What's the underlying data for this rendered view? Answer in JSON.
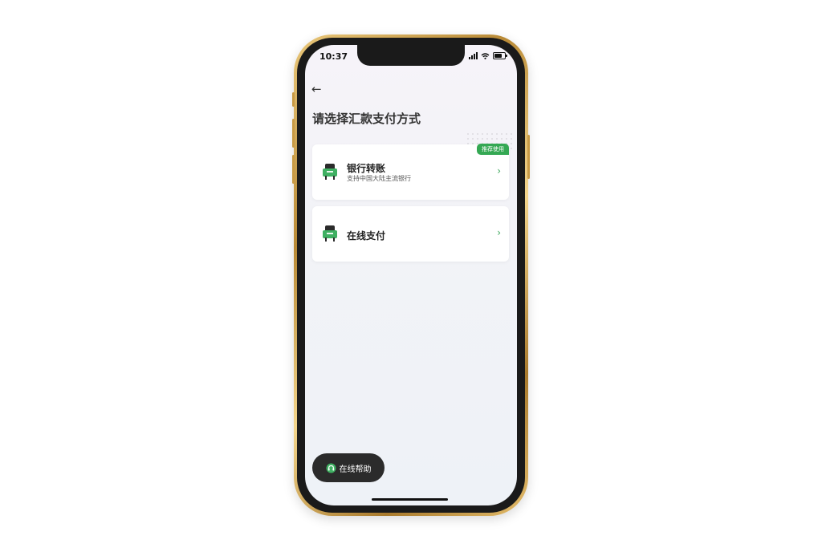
{
  "status_bar": {
    "time": "10:37"
  },
  "header": {
    "back_icon": "arrow-left-icon",
    "title": "请选择汇款支付方式"
  },
  "options": [
    {
      "title": "银行转账",
      "subtitle": "支持中国大陆主流银行",
      "badge": "推荐使用",
      "icon": "green-card-icon"
    },
    {
      "title": "在线支付",
      "icon": "green-card-icon"
    }
  ],
  "help": {
    "label": "在线帮助",
    "icon": "headset-icon"
  },
  "colors": {
    "accent": "#34a853",
    "help_bg": "#2b2b2b"
  }
}
